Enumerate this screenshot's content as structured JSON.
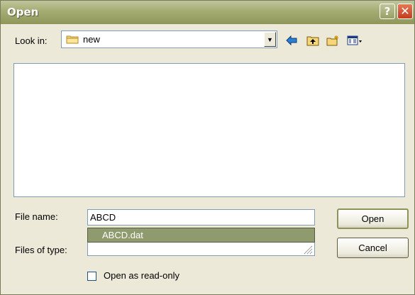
{
  "window": {
    "title": "Open",
    "help_label": "?",
    "close_label": "✕"
  },
  "look_in": {
    "label": "Look in:",
    "value": "new",
    "drop_arrow": "▼"
  },
  "toolbar": {
    "icons": [
      "back-arrow-icon",
      "up-folder-icon",
      "new-folder-icon",
      "view-menu-icon"
    ]
  },
  "file_name": {
    "label": "File name:",
    "value": "ABCD"
  },
  "autocomplete": {
    "items": [
      "ABCD.dat"
    ]
  },
  "files_of_type": {
    "label": "Files of type:",
    "value": ""
  },
  "buttons": {
    "open": "Open",
    "cancel": "Cancel"
  },
  "read_only": {
    "label": "Open as read-only",
    "checked": false
  },
  "colors": {
    "title_bar": "#a4ac73",
    "dialog_bg": "#ece9d8",
    "selection": "#8f9a6e",
    "close_button": "#c23c1c"
  }
}
